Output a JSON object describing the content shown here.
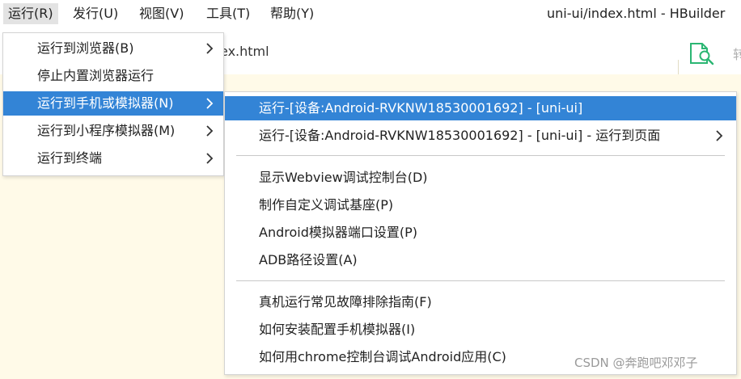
{
  "menubar": {
    "items": [
      {
        "label": "运行(R)",
        "active": true
      },
      {
        "label": "发行(U)"
      },
      {
        "label": "视图(V)"
      },
      {
        "label": "工具(T)"
      },
      {
        "label": "帮助(Y)"
      }
    ],
    "window_title": "uni-ui/index.html - HBuilder"
  },
  "tabbar": {
    "tab_label_visible": "ex.html",
    "find_icon": "find-in-file-icon",
    "cut_text": "转"
  },
  "run_menu": {
    "items": [
      {
        "label": "运行到浏览器(B)",
        "has_submenu": true
      },
      {
        "label": "停止内置浏览器运行",
        "has_submenu": false
      },
      {
        "label": "运行到手机或模拟器(N)",
        "has_submenu": true,
        "highlighted": true
      },
      {
        "label": "运行到小程序模拟器(M)",
        "has_submenu": true
      },
      {
        "label": "运行到终端",
        "has_submenu": true
      }
    ]
  },
  "device_submenu": {
    "items": [
      {
        "label": "运行-[设备:Android-RVKNW18530001692] - [uni-ui]",
        "highlighted": true
      },
      {
        "label": "运行-[设备:Android-RVKNW18530001692] - [uni-ui] - 运行到页面",
        "has_submenu": true
      },
      {
        "label": "显示Webview调试控制台(D)"
      },
      {
        "label": "制作自定义调试基座(P)"
      },
      {
        "label": "Android模拟器端口设置(P)"
      },
      {
        "label": "ADB路径设置(A)"
      },
      {
        "label": "真机运行常见故障排除指南(F)"
      },
      {
        "label": "如何安装配置手机模拟器(I)"
      },
      {
        "label": "如何用chrome控制台调试Android应用(C)"
      }
    ]
  },
  "watermark": "CSDN @奔跑吧邓邓子",
  "colors": {
    "highlight": "#3384d6",
    "editor_background": "#fffae8",
    "find_icon": "#2bb673"
  }
}
